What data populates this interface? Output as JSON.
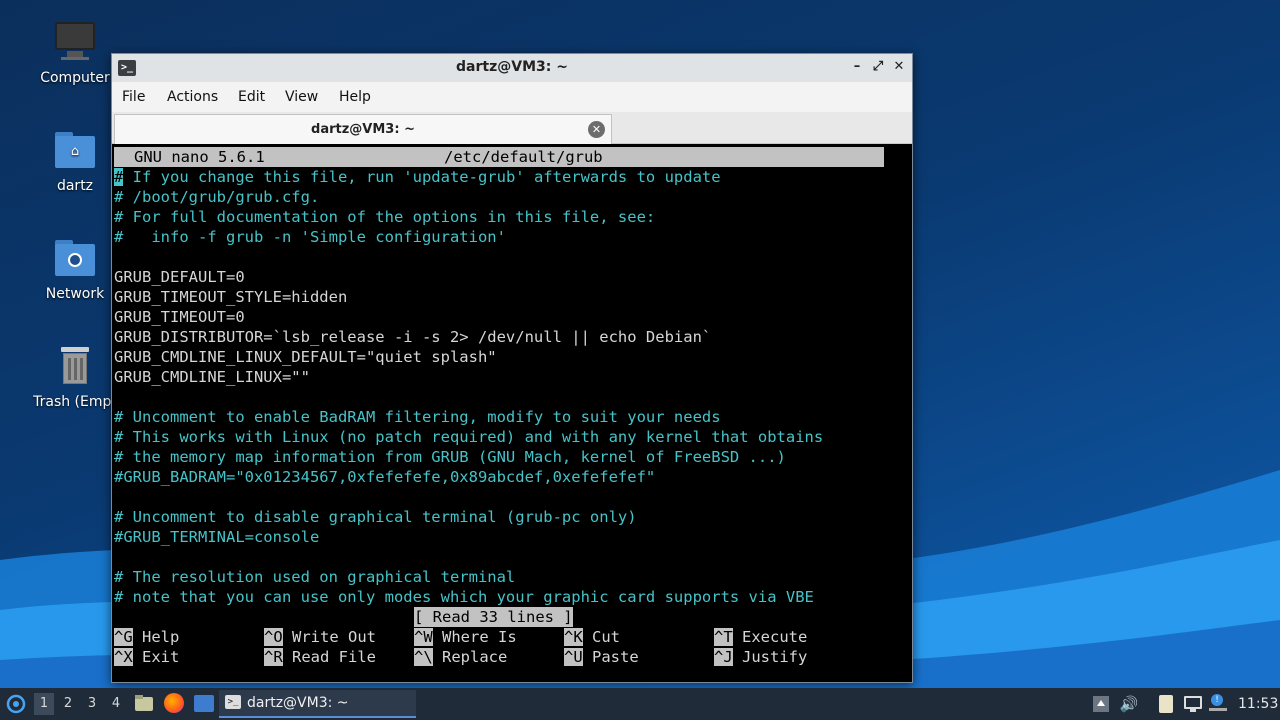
{
  "desktop": {
    "icons": [
      {
        "label": "Computer",
        "icon": "computer-icon"
      },
      {
        "label": "dartz",
        "icon": "home-folder-icon"
      },
      {
        "label": "Network",
        "icon": "network-folder-icon"
      },
      {
        "label": "Trash (Empt",
        "icon": "trash-icon"
      }
    ]
  },
  "window": {
    "title": "dartz@VM3: ~",
    "controls": {
      "minimize": "–",
      "maximize": "⤢",
      "close": "✕"
    },
    "menu": [
      "File",
      "Actions",
      "Edit",
      "View",
      "Help"
    ],
    "tab": {
      "label": "dartz@VM3: ~",
      "close": "✕"
    }
  },
  "nano": {
    "version": "GNU nano 5.6.1",
    "filename": "/etc/default/grub",
    "lines": [
      {
        "text": "# If you change this file, run 'update-grub' afterwards to update",
        "comment": true
      },
      {
        "text": "# /boot/grub/grub.cfg.",
        "comment": true
      },
      {
        "text": "# For full documentation of the options in this file, see:",
        "comment": true
      },
      {
        "text": "#   info -f grub -n 'Simple configuration'",
        "comment": true
      },
      {
        "text": "",
        "comment": false
      },
      {
        "text": "GRUB_DEFAULT=0",
        "comment": false
      },
      {
        "text": "GRUB_TIMEOUT_STYLE=hidden",
        "comment": false
      },
      {
        "text": "GRUB_TIMEOUT=0",
        "comment": false
      },
      {
        "text": "GRUB_DISTRIBUTOR=`lsb_release -i -s 2> /dev/null || echo Debian`",
        "comment": false
      },
      {
        "text": "GRUB_CMDLINE_LINUX_DEFAULT=\"quiet splash\"",
        "comment": false
      },
      {
        "text": "GRUB_CMDLINE_LINUX=\"\"",
        "comment": false
      },
      {
        "text": "",
        "comment": false
      },
      {
        "text": "# Uncomment to enable BadRAM filtering, modify to suit your needs",
        "comment": true
      },
      {
        "text": "# This works with Linux (no patch required) and with any kernel that obtains",
        "comment": true
      },
      {
        "text": "# the memory map information from GRUB (GNU Mach, kernel of FreeBSD ...)",
        "comment": true
      },
      {
        "text": "#GRUB_BADRAM=\"0x01234567,0xfefefefe,0x89abcdef,0xefefefef\"",
        "comment": true
      },
      {
        "text": "",
        "comment": false
      },
      {
        "text": "# Uncomment to disable graphical terminal (grub-pc only)",
        "comment": true
      },
      {
        "text": "#GRUB_TERMINAL=console",
        "comment": true
      },
      {
        "text": "",
        "comment": false
      },
      {
        "text": "# The resolution used on graphical terminal",
        "comment": true
      },
      {
        "text": "# note that you can use only modes which your graphic card supports via VBE",
        "comment": true
      }
    ],
    "status": "[ Read 33 lines ]",
    "shortcuts": [
      {
        "key": "^G",
        "label": "Help"
      },
      {
        "key": "^O",
        "label": "Write Out"
      },
      {
        "key": "^W",
        "label": "Where Is"
      },
      {
        "key": "^K",
        "label": "Cut"
      },
      {
        "key": "^T",
        "label": "Execute"
      },
      {
        "key": "^X",
        "label": "Exit"
      },
      {
        "key": "^R",
        "label": "Read File"
      },
      {
        "key": "^\\",
        "label": "Replace"
      },
      {
        "key": "^U",
        "label": "Paste"
      },
      {
        "key": "^J",
        "label": "Justify"
      }
    ]
  },
  "taskbar": {
    "workspaces": [
      "1",
      "2",
      "3",
      "4"
    ],
    "active_workspace": "1",
    "task_label": "dartz@VM3: ~",
    "clock": "11:53"
  },
  "colors": {
    "comment": "#46c3c8",
    "taskbar": "#1f2b39",
    "accent": "#5a8fd6"
  }
}
